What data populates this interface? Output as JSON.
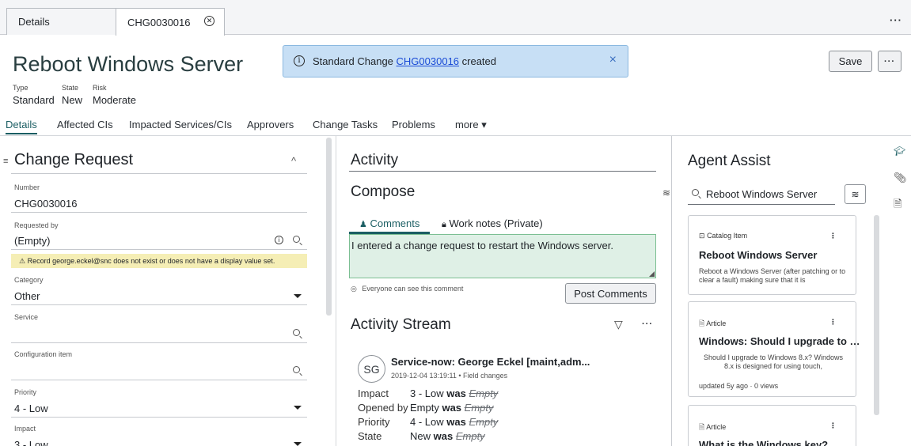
{
  "tabs": [
    {
      "label": "Details"
    },
    {
      "label": "CHG0030016",
      "close": "⊗"
    }
  ],
  "topbar_more": "···",
  "record": {
    "title": "Reboot Windows Server",
    "meta": [
      {
        "label": "Type",
        "value": "Standard"
      },
      {
        "label": "State",
        "value": "New"
      },
      {
        "label": "Risk",
        "value": "Moderate"
      }
    ]
  },
  "banner": {
    "prefix": "Standard Change ",
    "link": "CHG0030016",
    "suffix": " created",
    "close": "×"
  },
  "actions": {
    "save": "Save",
    "more": "···"
  },
  "form_tabs": [
    "Details",
    "Affected CIs",
    "Impacted Services/CIs",
    "Approvers",
    "Change Tasks",
    "Problems",
    "more ▾"
  ],
  "form": {
    "section_title": "Change Request",
    "collapse": "^",
    "fields": {
      "number": {
        "label": "Number",
        "value": "CHG0030016"
      },
      "requested_by": {
        "label": "Requested by",
        "value": "(Empty)"
      },
      "warning": "⚠  Record george.eckel@snc does not exist or does not have a display value set.",
      "category": {
        "label": "Category",
        "value": "Other"
      },
      "service": {
        "label": "Service",
        "value": ""
      },
      "config_item": {
        "label": "Configuration item",
        "value": ""
      },
      "priority": {
        "label": "Priority",
        "value": "4 - Low"
      },
      "impact": {
        "label": "Impact",
        "value": "3 - Low"
      }
    }
  },
  "activity": {
    "title": "Activity",
    "compose_title": "Compose",
    "tab_comments": "Comments",
    "tab_worknotes": "Work notes (Private)",
    "comment_text": "I entered a change request to restart the Windows server.",
    "visibility_note": "Everyone can see this comment",
    "post_button": "Post Comments",
    "stream_title": "Activity Stream",
    "entry": {
      "initials": "SG",
      "author": "Service-now: George Eckel [maint,adm...",
      "meta": "2019-12-04 13:19:11 • Field changes",
      "changes": [
        {
          "field": "Impact",
          "new": "3 - Low",
          "was": "was",
          "old": "Empty"
        },
        {
          "field": "Opened by",
          "new": "Empty",
          "was": "was",
          "old": "Empty"
        },
        {
          "field": "Priority",
          "new": "4 - Low",
          "was": "was",
          "old": "Empty"
        },
        {
          "field": "State",
          "new": "New",
          "was": "was",
          "old": "Empty"
        }
      ]
    }
  },
  "agent_assist": {
    "title": "Agent Assist",
    "search_value": "Reboot Windows Server",
    "cards": [
      {
        "type": "Catalog Item",
        "title": "Reboot Windows Server",
        "body": "Reboot a Windows Server (after patching or to clear a fault) making sure that it is",
        "footer": ""
      },
      {
        "type": "Article",
        "title": "Windows: Should I upgrade to …",
        "body": "Should I upgrade to Windows 8.x? Windows 8.x is designed for using touch,",
        "footer": "updated 5y ago · 0 views"
      },
      {
        "type": "Article",
        "title": "What is the Windows key?",
        "body": "",
        "footer": ""
      }
    ]
  },
  "colors": {
    "accent": "#1b5e63",
    "banner": "#c7dff5",
    "warning": "#f5eeb5",
    "comment_bg": "#dff0e6"
  }
}
